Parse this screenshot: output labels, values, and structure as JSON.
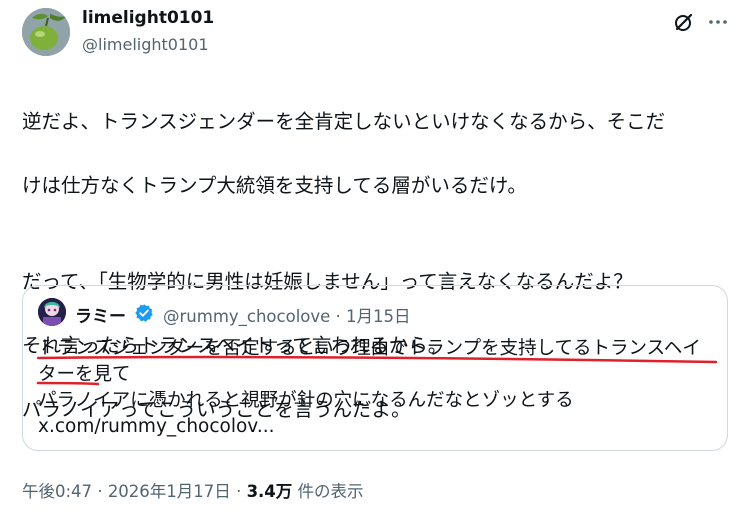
{
  "author": {
    "display_name": "limelight0101",
    "handle": "@limelight0101",
    "avatar_icon": "lime-fruit-icon"
  },
  "actions": {
    "grok_icon": "grok-icon",
    "more_icon": "more-icon"
  },
  "tweet": {
    "line1": "逆だよ、トランスジェンダーを全肯定しないといけなくなるから、そこだ",
    "line2": "けは仕方なくトランプ大統領を支持してる層がいるだけ。",
    "line3": "だって、「生物学的に男性は妊娠しません」って言えなくなるんだよ？",
    "line4": "それ言ったらトランスヘイトって言われるから。",
    "line5": "パラノイアってこういうことを言うんだよ。"
  },
  "quote": {
    "display_name": "ラミー",
    "verified_icon": "verified-badge-icon",
    "handle": "@rummy_chocolove",
    "separator": "·",
    "date": "1月15日",
    "line1": "トランスジェンダーを否定するという理由でトランプを支持してるトランスヘイ",
    "line2": "ターを見て",
    "line3": "パラノイアに憑かれると視野が針の穴になるんだなとゾッとする",
    "link": "x.com/rummy_chocolov...",
    "underline_color": "#e0202a"
  },
  "footer": {
    "time": "午後0:47",
    "separator1": "·",
    "date": "2026年1月17日",
    "separator2": "·",
    "views_count": "3.4万",
    "views_label": "件の表示"
  },
  "colors": {
    "text": "#0f1419",
    "secondary": "#536471",
    "border": "#cfd9de",
    "verified": "#1d9bf0"
  }
}
